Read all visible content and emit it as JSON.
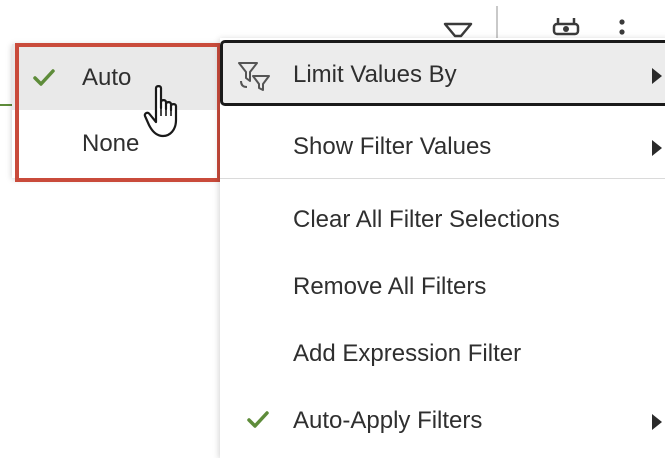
{
  "toolbar": {
    "icons": [
      "filter-icon",
      "gear-icon",
      "more-icon"
    ]
  },
  "submenu": {
    "items": [
      {
        "label": "Auto",
        "checked": true,
        "hovered": true
      },
      {
        "label": "None",
        "checked": false,
        "hovered": false
      }
    ]
  },
  "menu": {
    "items": [
      {
        "label": "Limit Values By",
        "icon": "limit-values-icon",
        "has_submenu": true,
        "active": true
      },
      {
        "label": "Show Filter Values",
        "has_submenu": true
      },
      {
        "label": "Clear All Filter Selections",
        "has_submenu": false
      },
      {
        "label": "Remove All Filters",
        "has_submenu": false
      },
      {
        "label": "Add Expression Filter",
        "has_submenu": false
      },
      {
        "label": "Auto-Apply Filters",
        "checked": true,
        "has_submenu": true
      }
    ]
  },
  "colors": {
    "check": "#5e8c3a",
    "highlight_box": "#c94b3b",
    "hover_bg": "#e9e9e9",
    "active_border": "#1a1a1a"
  }
}
